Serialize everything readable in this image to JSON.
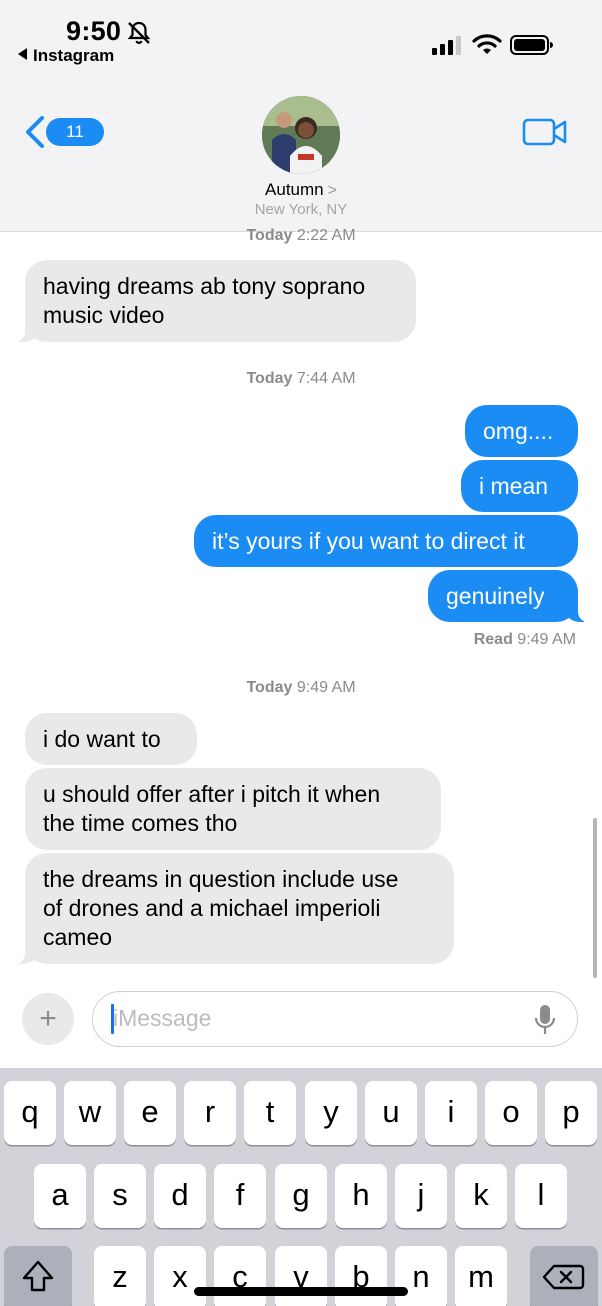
{
  "status_bar": {
    "time": "9:50",
    "back_app": "Instagram"
  },
  "header": {
    "unread_count": "11",
    "contact_name": "Autumn",
    "contact_chevron": ">",
    "contact_location": "New York, NY"
  },
  "messages": {
    "ts1": {
      "day": "Today",
      "time": "2:22 AM"
    },
    "m1_line1": "having dreams ab tony soprano",
    "m1_line2": "music video",
    "ts2": {
      "day": "Today",
      "time": "7:44 AM"
    },
    "m2": "omg....",
    "m3": "i mean",
    "m4": "it’s yours if you want to direct it",
    "m5": "genuinely",
    "read": {
      "label": "Read",
      "time": "9:49 AM"
    },
    "ts3": {
      "day": "Today",
      "time": "9:49 AM"
    },
    "m6": "i do want to",
    "m7_line1": "u should offer after i pitch it when",
    "m7_line2": "the time comes tho",
    "m8_line1": "the dreams in question include use",
    "m8_line2": "of drones and a michael imperioli",
    "m8_line3": "cameo"
  },
  "composer": {
    "plus": "+",
    "placeholder": "iMessage"
  },
  "keyboard": {
    "row1": [
      "q",
      "w",
      "e",
      "r",
      "t",
      "y",
      "u",
      "i",
      "o",
      "p"
    ],
    "row2": [
      "a",
      "s",
      "d",
      "f",
      "g",
      "h",
      "j",
      "k",
      "l"
    ],
    "row3": [
      "z",
      "x",
      "c",
      "v",
      "b",
      "n",
      "m"
    ]
  },
  "colors": {
    "accent": "#1a8cf3",
    "incoming_bubble": "#e9e9eb",
    "keyboard_bg": "#d1d3d9"
  }
}
